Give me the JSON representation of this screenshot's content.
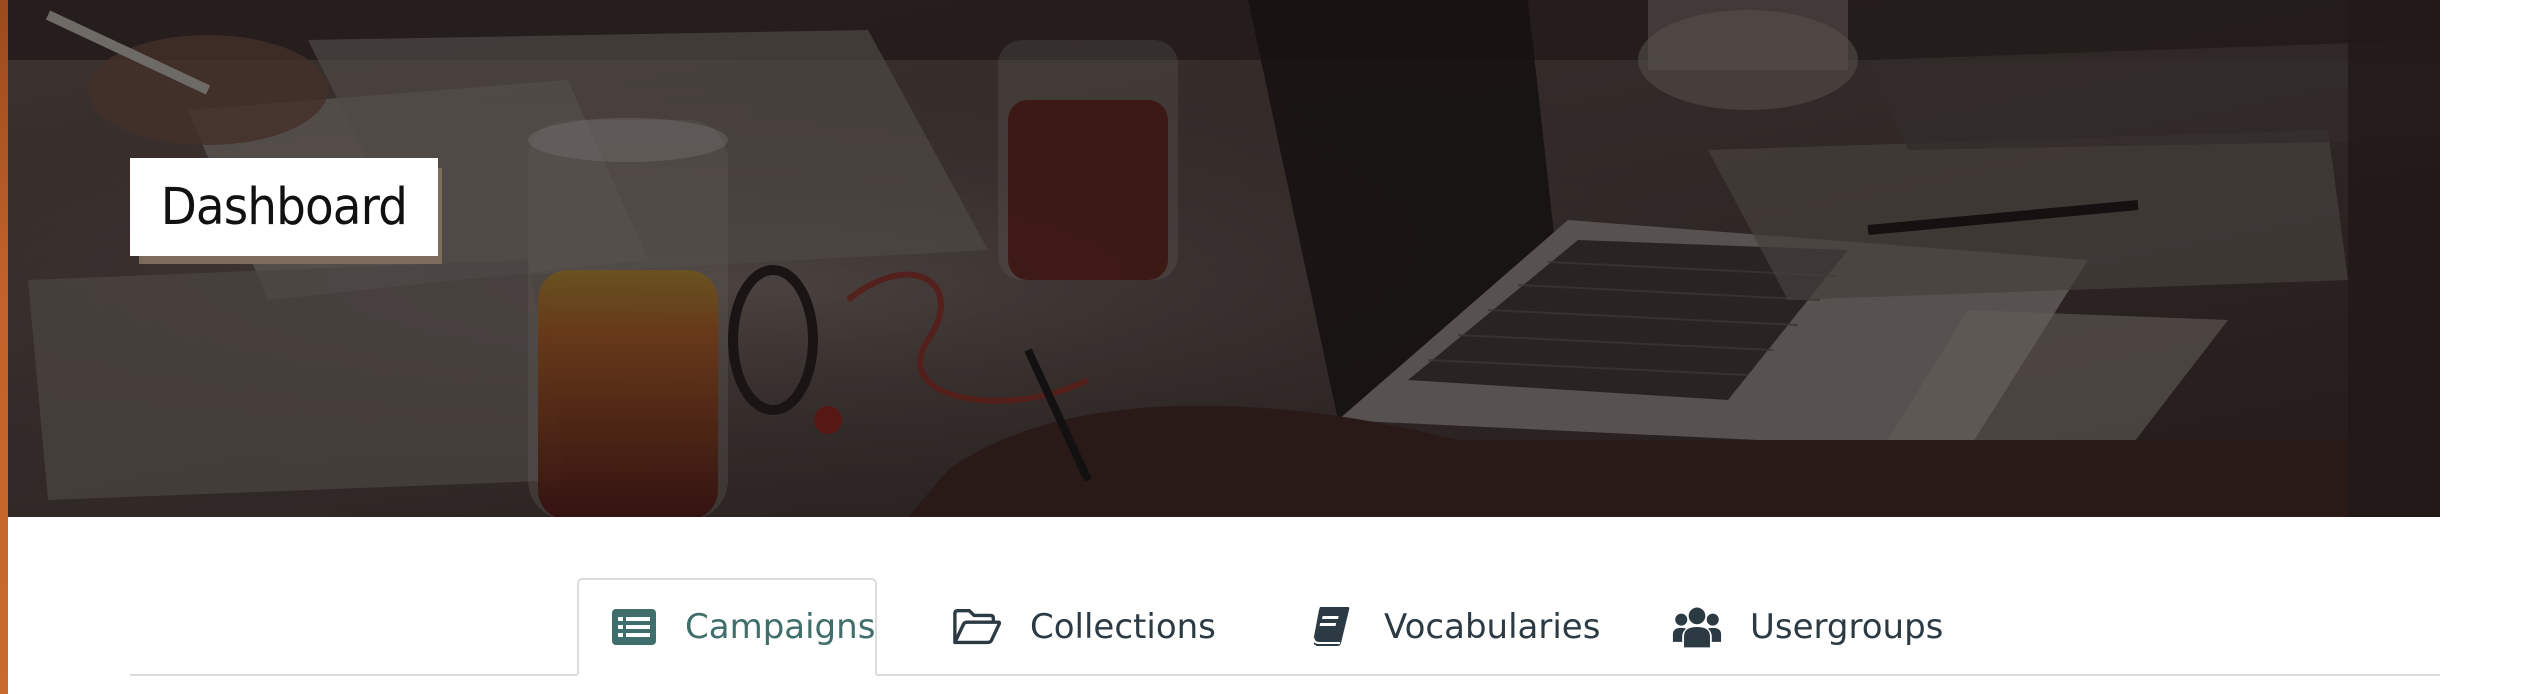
{
  "page": {
    "title": "Dashboard"
  },
  "tabs": [
    {
      "label": "Campaigns",
      "icon": "list-alt-icon",
      "active": true
    },
    {
      "label": "Collections",
      "icon": "folder-open-icon",
      "active": false
    },
    {
      "label": "Vocabularies",
      "icon": "book-icon",
      "active": false
    },
    {
      "label": "Usergroups",
      "icon": "users-icon",
      "active": false
    }
  ],
  "colors": {
    "active_tab": "#3f6e6b",
    "tab_text": "#2c3a44",
    "tab_border": "#dcdcdc",
    "banner_dark": "#2b2321",
    "title_shadow": "#7d6c5b",
    "left_edge": "#c0612a"
  }
}
